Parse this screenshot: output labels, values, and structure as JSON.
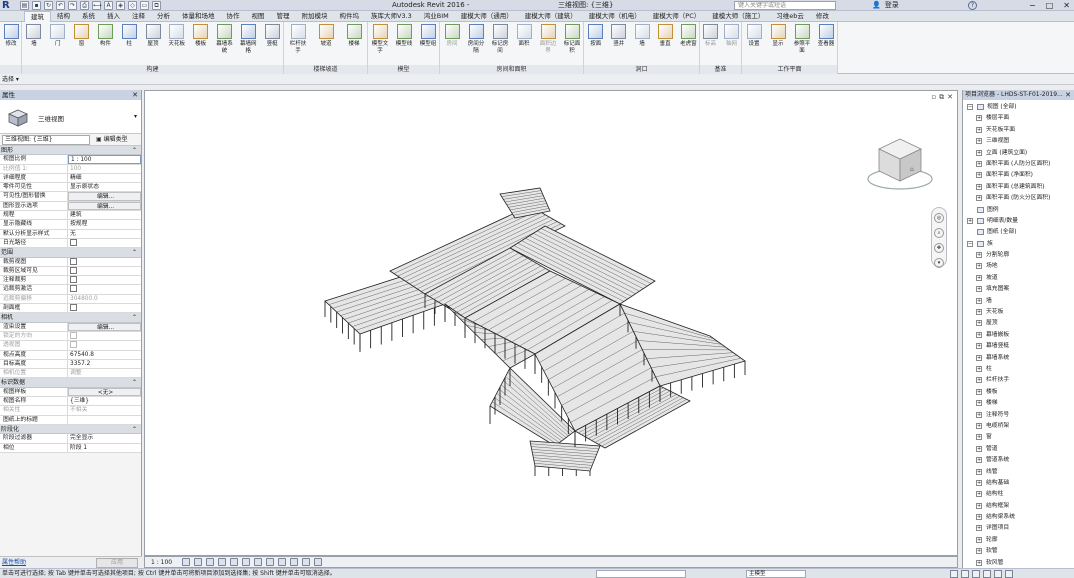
{
  "app": {
    "title": "Autodesk Revit 2016 -",
    "document": "三维视图: {三维}",
    "search_placeholder": "键入关键字或短语",
    "user_label": "登录",
    "help_label": "?"
  },
  "ribbon_tabs": [
    "建筑",
    "结构",
    "系统",
    "插入",
    "注释",
    "分析",
    "体量和场地",
    "协作",
    "视图",
    "管理",
    "附加模块",
    "构件坞",
    "族库大师V3.3",
    "鸿业BIM",
    "建模大师（通用）",
    "建模大师（建筑）",
    "建模大师（机电）",
    "建模大师（PC）",
    "建模大师（施工）",
    "习维eb云",
    "修改"
  ],
  "ribbon_groups": [
    {
      "label": "",
      "buttons": [
        "修改"
      ]
    },
    {
      "label": "构建",
      "buttons": [
        "墙",
        "门",
        "窗",
        "构件",
        "柱",
        "屋顶",
        "天花板",
        "楼板",
        "幕墙系统",
        "幕墙网格",
        "竖梃"
      ]
    },
    {
      "label": "楼梯坡道",
      "buttons": [
        "栏杆扶手",
        "坡道",
        "楼梯"
      ]
    },
    {
      "label": "模型",
      "buttons": [
        "模型文字",
        "模型线",
        "模型组"
      ]
    },
    {
      "label": "房间和面积",
      "buttons": [
        "房间",
        "房间分隔",
        "标记房间",
        "面积",
        "面积边界",
        "标记面积"
      ]
    },
    {
      "label": "洞口",
      "buttons": [
        "按面",
        "竖井",
        "墙",
        "垂直",
        "老虎窗"
      ]
    },
    {
      "label": "基准",
      "buttons": [
        "标高",
        "轴网"
      ]
    },
    {
      "label": "工作平面",
      "buttons": [
        "设置",
        "显示",
        "参照平面",
        "查看器"
      ]
    }
  ],
  "select_label": "选择 ▾",
  "properties": {
    "title": "属性",
    "type_name": "三维视图",
    "view_select": "三维视图: {三维}",
    "edit_type": "编辑类型",
    "sections": [
      {
        "name": "图形",
        "rows": [
          {
            "n": "视图比例",
            "v": "1 : 100",
            "kind": "input"
          },
          {
            "n": "比例值 1:",
            "v": "100",
            "dim": true
          },
          {
            "n": "详细程度",
            "v": "精细"
          },
          {
            "n": "零件可见性",
            "v": "显示原状态"
          },
          {
            "n": "可见性/图形替换",
            "v": "编辑...",
            "kind": "btn"
          },
          {
            "n": "图形显示选项",
            "v": "编辑...",
            "kind": "btn"
          },
          {
            "n": "规程",
            "v": "建筑"
          },
          {
            "n": "显示隐藏线",
            "v": "按规程"
          },
          {
            "n": "默认分析显示样式",
            "v": "无"
          },
          {
            "n": "日光路径",
            "v": "",
            "kind": "chk"
          }
        ]
      },
      {
        "name": "范围",
        "rows": [
          {
            "n": "裁剪视图",
            "v": "",
            "kind": "chk"
          },
          {
            "n": "裁剪区域可见",
            "v": "",
            "kind": "chk"
          },
          {
            "n": "注释裁剪",
            "v": "",
            "kind": "chk"
          },
          {
            "n": "远裁剪激活",
            "v": "",
            "kind": "chk"
          },
          {
            "n": "远裁剪偏移",
            "v": "304800.0",
            "dim": true
          },
          {
            "n": "剖面框",
            "v": "",
            "kind": "chk"
          }
        ]
      },
      {
        "name": "相机",
        "rows": [
          {
            "n": "渲染设置",
            "v": "编辑...",
            "kind": "btn"
          },
          {
            "n": "锁定的方向",
            "v": "",
            "kind": "chk",
            "dim": true
          },
          {
            "n": "透视图",
            "v": "",
            "kind": "chk",
            "dim": true
          },
          {
            "n": "视点高度",
            "v": "67540.8"
          },
          {
            "n": "目标高度",
            "v": "3357.2"
          },
          {
            "n": "相机位置",
            "v": "调整",
            "dim": true
          }
        ]
      },
      {
        "name": "标识数据",
        "rows": [
          {
            "n": "视图样板",
            "v": "<无>",
            "kind": "btn"
          },
          {
            "n": "视图名称",
            "v": "{三维}"
          },
          {
            "n": "相关性",
            "v": "不相关",
            "dim": true
          },
          {
            "n": "图纸上的标题",
            "v": ""
          }
        ]
      },
      {
        "name": "阶段化",
        "rows": [
          {
            "n": "阶段过滤器",
            "v": "完全显示"
          },
          {
            "n": "相位",
            "v": "阶段 1"
          }
        ]
      }
    ],
    "help_link": "属性帮助",
    "apply": "应用"
  },
  "view_control": {
    "scale": "1 : 100"
  },
  "browser": {
    "title": "项目浏览器 - LHDS-ST-F01-2019...",
    "items": [
      {
        "t": "视图 (全部)",
        "lvl": 0,
        "tog": "−"
      },
      {
        "t": "楼层平面",
        "lvl": 1,
        "tog": "+"
      },
      {
        "t": "天花板平面",
        "lvl": 1,
        "tog": "+"
      },
      {
        "t": "三维视图",
        "lvl": 1,
        "tog": "+"
      },
      {
        "t": "立面 (建筑立面)",
        "lvl": 1,
        "tog": "+"
      },
      {
        "t": "面积平面 (人防分区面积)",
        "lvl": 1,
        "tog": "+"
      },
      {
        "t": "面积平面 (净面积)",
        "lvl": 1,
        "tog": "+"
      },
      {
        "t": "面积平面 (总建筑面积)",
        "lvl": 1,
        "tog": "+"
      },
      {
        "t": "面积平面 (防火分区面积)",
        "lvl": 1,
        "tog": "+"
      },
      {
        "t": "图例",
        "lvl": 0,
        "tog": ""
      },
      {
        "t": "明细表/数量",
        "lvl": 0,
        "tog": "+"
      },
      {
        "t": "图纸 (全部)",
        "lvl": 0,
        "tog": ""
      },
      {
        "t": "族",
        "lvl": 0,
        "tog": "−"
      },
      {
        "t": "分割轮廓",
        "lvl": 1,
        "tog": "+"
      },
      {
        "t": "场地",
        "lvl": 1,
        "tog": "+"
      },
      {
        "t": "坡道",
        "lvl": 1,
        "tog": "+"
      },
      {
        "t": "填充图案",
        "lvl": 1,
        "tog": "+"
      },
      {
        "t": "墙",
        "lvl": 1,
        "tog": "+"
      },
      {
        "t": "天花板",
        "lvl": 1,
        "tog": "+"
      },
      {
        "t": "屋顶",
        "lvl": 1,
        "tog": "+"
      },
      {
        "t": "幕墙嵌板",
        "lvl": 1,
        "tog": "+"
      },
      {
        "t": "幕墙竖梃",
        "lvl": 1,
        "tog": "+"
      },
      {
        "t": "幕墙系统",
        "lvl": 1,
        "tog": "+"
      },
      {
        "t": "柱",
        "lvl": 1,
        "tog": "+"
      },
      {
        "t": "栏杆扶手",
        "lvl": 1,
        "tog": "+"
      },
      {
        "t": "楼板",
        "lvl": 1,
        "tog": "+"
      },
      {
        "t": "楼梯",
        "lvl": 1,
        "tog": "+"
      },
      {
        "t": "注释符号",
        "lvl": 1,
        "tog": "+"
      },
      {
        "t": "电缆桥架",
        "lvl": 1,
        "tog": "+"
      },
      {
        "t": "窗",
        "lvl": 1,
        "tog": "+"
      },
      {
        "t": "管道",
        "lvl": 1,
        "tog": "+"
      },
      {
        "t": "管道系统",
        "lvl": 1,
        "tog": "+"
      },
      {
        "t": "线管",
        "lvl": 1,
        "tog": "+"
      },
      {
        "t": "结构基础",
        "lvl": 1,
        "tog": "+"
      },
      {
        "t": "结构柱",
        "lvl": 1,
        "tog": "+"
      },
      {
        "t": "结构框架",
        "lvl": 1,
        "tog": "+"
      },
      {
        "t": "结构梁系统",
        "lvl": 1,
        "tog": "+"
      },
      {
        "t": "详图项目",
        "lvl": 1,
        "tog": "+"
      },
      {
        "t": "轮廓",
        "lvl": 1,
        "tog": "+"
      },
      {
        "t": "软管",
        "lvl": 1,
        "tog": "+"
      },
      {
        "t": "软风管",
        "lvl": 1,
        "tog": "+"
      }
    ]
  },
  "status": {
    "text": "单击可进行选择; 按 Tab 键并单击可选择其他项目; 按 Ctrl 键并单击可将新项目添加到选择集; 按 Shift 键并单击可取消选择。",
    "model_label": "主模型"
  },
  "colors": {
    "accent": "#1d3f8a",
    "panel_title": "#c9d2e3"
  }
}
